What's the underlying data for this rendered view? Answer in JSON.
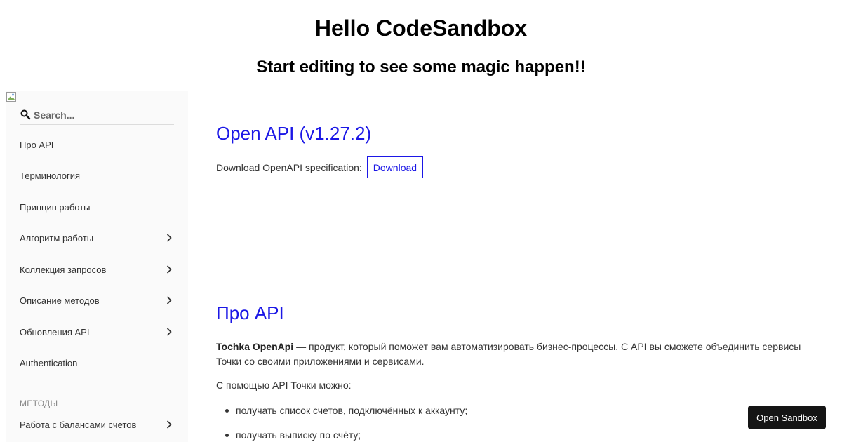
{
  "header": {
    "title": "Hello CodeSandbox",
    "subtitle": "Start editing to see some magic happen!!"
  },
  "sidebar": {
    "search_placeholder": "Search...",
    "items": [
      {
        "label": "Про API",
        "has_children": false
      },
      {
        "label": "Терминология",
        "has_children": false
      },
      {
        "label": "Принцип работы",
        "has_children": false
      },
      {
        "label": "Алгоритм работы",
        "has_children": true
      },
      {
        "label": "Коллекция запросов",
        "has_children": true
      },
      {
        "label": "Описание методов",
        "has_children": true
      },
      {
        "label": "Обновления API",
        "has_children": true
      },
      {
        "label": "Authentication",
        "has_children": false
      }
    ],
    "section_label": "МЕТОДЫ",
    "section_items": [
      {
        "label": "Работа с балансами счетов",
        "has_children": true
      }
    ]
  },
  "main": {
    "api_title": "Open API (v1.27.2)",
    "download_label": "Download OpenAPI specification:",
    "download_button": "Download",
    "about_title": "Про API",
    "intro_bold": "Tochka OpenApi",
    "intro_text": " — продукт, который поможет вам автоматизировать бизнес-процессы. С API вы сможете объединить сервисы Точки со своими приложениями и сервисами.",
    "lead": "С помощью API Точки можно:",
    "features": [
      "получать список счетов, подключённых к аккаунту;",
      "получать выписку по счёту;"
    ]
  },
  "open_sandbox_label": "Open Sandbox",
  "colors": {
    "accent": "#1b17e6",
    "sidebar_bg": "#fafafa",
    "sandbox_button_bg": "#151515"
  },
  "icons": {
    "search": "search-icon",
    "chevron": "chevron-right-icon",
    "broken_image": "broken-image-icon"
  }
}
